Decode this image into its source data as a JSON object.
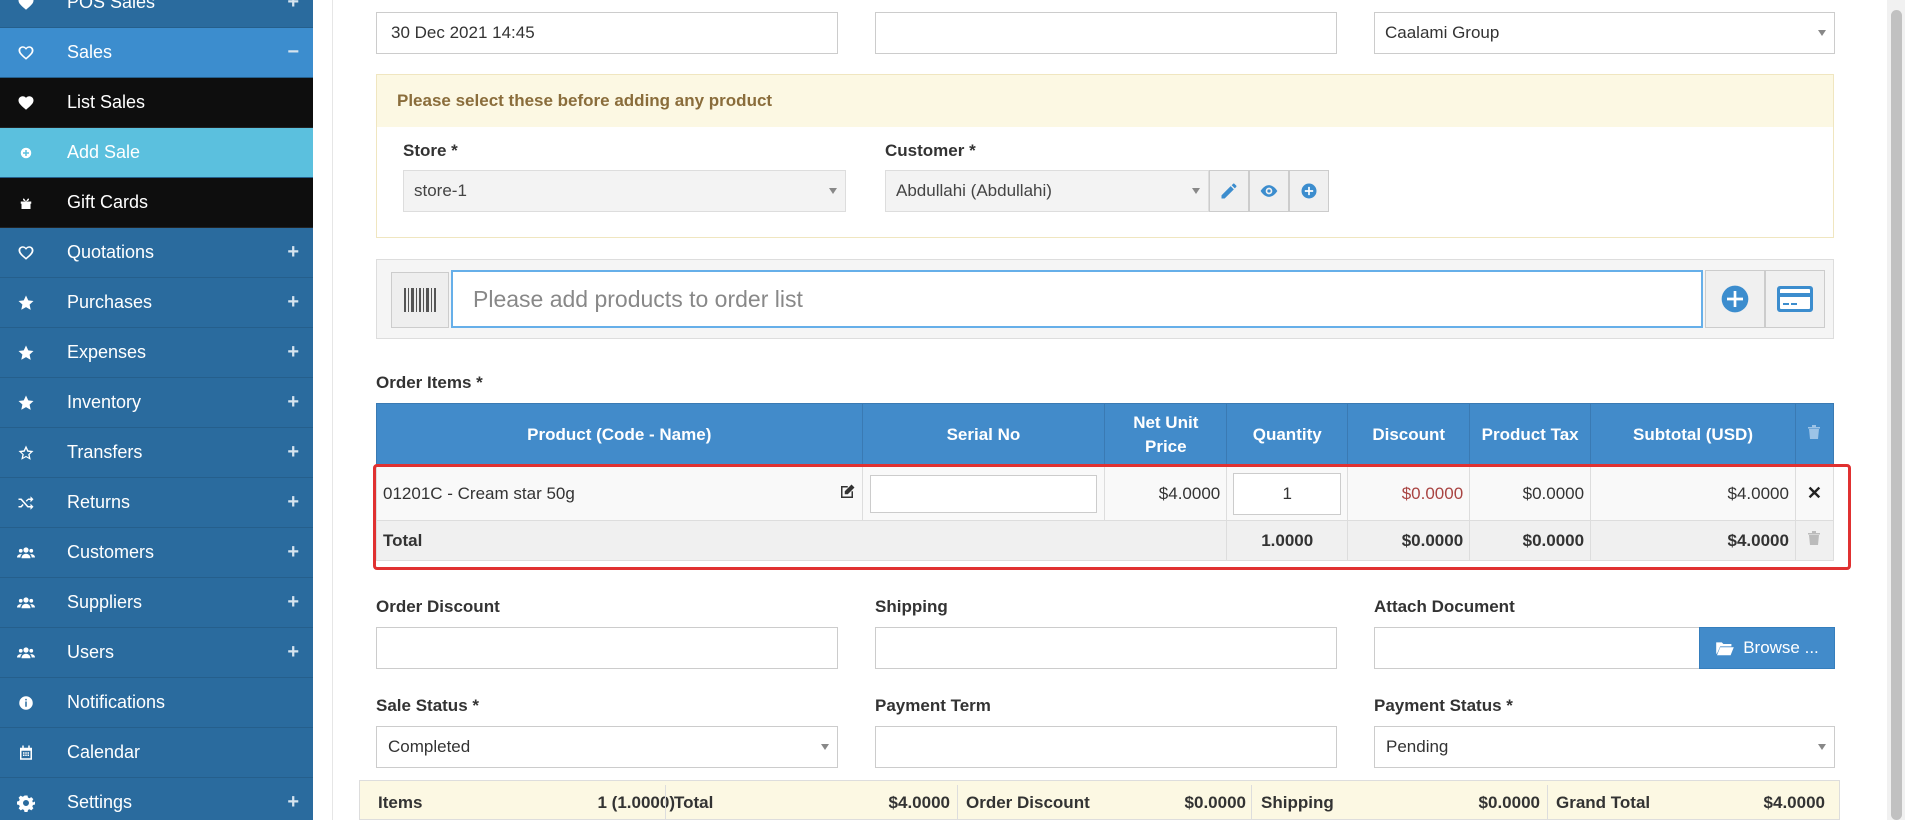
{
  "sidebar": {
    "items": [
      {
        "label": "POS Sales",
        "icon": "heart-icon",
        "expand": "+"
      },
      {
        "label": "Sales",
        "icon": "heart-outline-icon",
        "expand": "−"
      },
      {
        "label": "List Sales",
        "icon": "heart-icon"
      },
      {
        "label": "Add Sale",
        "icon": "plus-circle-icon"
      },
      {
        "label": "Gift Cards",
        "icon": "gift-icon"
      },
      {
        "label": "Quotations",
        "icon": "heart-outline-icon",
        "expand": "+"
      },
      {
        "label": "Purchases",
        "icon": "star-icon",
        "expand": "+"
      },
      {
        "label": "Expenses",
        "icon": "star-icon",
        "expand": "+"
      },
      {
        "label": "Inventory",
        "icon": "star-icon",
        "expand": "+"
      },
      {
        "label": "Transfers",
        "icon": "star-outline-icon",
        "expand": "+"
      },
      {
        "label": "Returns",
        "icon": "random-icon",
        "expand": "+"
      },
      {
        "label": "Customers",
        "icon": "users-icon",
        "expand": "+"
      },
      {
        "label": "Suppliers",
        "icon": "users-icon",
        "expand": "+"
      },
      {
        "label": "Users",
        "icon": "users-icon",
        "expand": "+"
      },
      {
        "label": "Notifications",
        "icon": "info-icon"
      },
      {
        "label": "Calendar",
        "icon": "calendar-icon"
      },
      {
        "label": "Settings",
        "icon": "gear-icon",
        "expand": "+"
      }
    ]
  },
  "top": {
    "date": "30 Dec 2021 14:45",
    "reference": "",
    "biller": "Caalami Group"
  },
  "notice": {
    "text": "Please select these before adding any product",
    "store_label": "Store *",
    "store_value": "store-1",
    "customer_label": "Customer *",
    "customer_value": "Abdullahi (Abdullahi)"
  },
  "search": {
    "placeholder": "Please add products to order list"
  },
  "order": {
    "title": "Order Items *",
    "headers": [
      "Product (Code - Name)",
      "Serial No",
      "Net Unit Price",
      "Quantity",
      "Discount",
      "Product Tax",
      "Subtotal (USD)"
    ],
    "row": {
      "product": "01201C - Cream star 50g",
      "serial": "",
      "price": "$4.0000",
      "quantity": "1",
      "discount": "$0.0000",
      "tax": "$0.0000",
      "subtotal": "$4.0000"
    },
    "total": {
      "label": "Total",
      "quantity": "1.0000",
      "discount": "$0.0000",
      "tax": "$0.0000",
      "subtotal": "$4.0000"
    }
  },
  "form": {
    "order_discount_label": "Order Discount",
    "shipping_label": "Shipping",
    "attach_label": "Attach Document",
    "browse_label": "Browse ...",
    "sale_status_label": "Sale Status *",
    "sale_status_value": "Completed",
    "payment_term_label": "Payment Term",
    "payment_status_label": "Payment Status *",
    "payment_status_value": "Pending"
  },
  "summary": {
    "items_label": "Items",
    "items_value": "1 (1.0000)",
    "total_label": "Total",
    "total_value": "$4.0000",
    "discount_label": "Order Discount",
    "discount_value": "$0.0000",
    "shipping_label": "Shipping",
    "shipping_value": "$0.0000",
    "grand_label": "Grand Total",
    "grand_value": "$4.0000"
  },
  "colors": {
    "sidebar": "#2a6b9e",
    "active": "#3c8dce",
    "primary": "#428bca",
    "highlight": "#e03131"
  }
}
